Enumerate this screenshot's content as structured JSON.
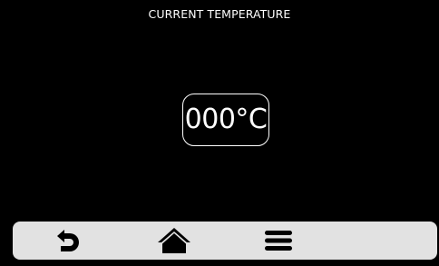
{
  "header": {
    "title": "CURRENT TEMPERATURE"
  },
  "temperature": {
    "display": "000°C"
  },
  "navbar": {
    "background": "#e2e2e2",
    "icon_color": "#000000",
    "buttons": [
      {
        "icon": "back-arrow-icon"
      },
      {
        "icon": "home-icon"
      },
      {
        "icon": "menu-icon"
      }
    ]
  }
}
